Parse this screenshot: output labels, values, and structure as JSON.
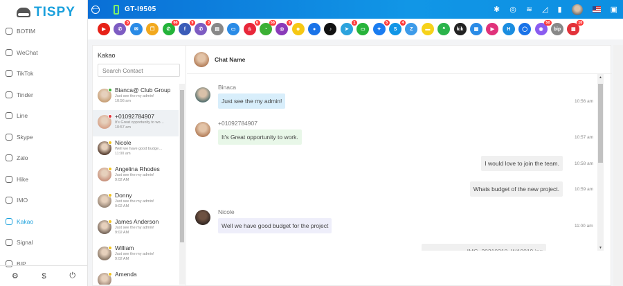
{
  "brand": {
    "name": "TISPY"
  },
  "sidebar": {
    "items": [
      {
        "label": "BOTIM",
        "icon": "botim-icon"
      },
      {
        "label": "WeChat",
        "icon": "wechat-icon"
      },
      {
        "label": "TikTok",
        "icon": "tiktok-icon"
      },
      {
        "label": "Tinder",
        "icon": "tinder-icon"
      },
      {
        "label": "Line",
        "icon": "line-icon"
      },
      {
        "label": "Skype",
        "icon": "skype-icon"
      },
      {
        "label": "Zalo",
        "icon": "zalo-icon"
      },
      {
        "label": "Hike",
        "icon": "hike-icon"
      },
      {
        "label": "IMO",
        "icon": "imo-icon"
      },
      {
        "label": "Kakao",
        "icon": "kakao-icon",
        "active": true
      },
      {
        "label": "Signal",
        "icon": "signal-icon"
      },
      {
        "label": "BIP",
        "icon": "bip-icon"
      }
    ],
    "footer": {
      "settings": "⚙",
      "pricing": "$",
      "logout": "⏻"
    }
  },
  "header": {
    "device": "GT-I9505",
    "back_glyph": "⟵",
    "icons": {
      "bluetooth": "✱",
      "location": "◎",
      "wifi": "≋",
      "signal": "◿",
      "battery": "▮",
      "gift": "▣"
    }
  },
  "apps": [
    {
      "name": "youtube",
      "color": "#e62117",
      "glyph": "▶",
      "badge": ""
    },
    {
      "name": "viber",
      "color": "#7d5cc2",
      "glyph": "✆",
      "badge": "5"
    },
    {
      "name": "email",
      "color": "#2a8be6",
      "glyph": "✉",
      "badge": ""
    },
    {
      "name": "files",
      "color": "#f2a81d",
      "glyph": "❐",
      "badge": ""
    },
    {
      "name": "whatsapp",
      "color": "#23b33a",
      "glyph": "✆",
      "badge": "66"
    },
    {
      "name": "facebook",
      "color": "#3b5cb8",
      "glyph": "f",
      "badge": "9"
    },
    {
      "name": "messenger-viber",
      "color": "#7d5cc2",
      "glyph": "✆",
      "badge": "3"
    },
    {
      "name": "clipboard",
      "color": "#888888",
      "glyph": "▤",
      "badge": ""
    },
    {
      "name": "screen",
      "color": "#2a8be6",
      "glyph": "▭",
      "badge": ""
    },
    {
      "name": "tinder",
      "color": "#e8273a",
      "glyph": "♨",
      "badge": "6"
    },
    {
      "name": "wechat",
      "color": "#3cb034",
      "glyph": "◔",
      "badge": "56"
    },
    {
      "name": "instagram",
      "color": "#8a3ab9",
      "glyph": "◎",
      "badge": "9"
    },
    {
      "name": "snapchat",
      "color": "#f6c813",
      "glyph": "☻",
      "badge": ""
    },
    {
      "name": "duo",
      "color": "#1a73e8",
      "glyph": "●",
      "badge": ""
    },
    {
      "name": "tiktok",
      "color": "#111111",
      "glyph": "♪",
      "badge": ""
    },
    {
      "name": "telegram",
      "color": "#2ca3dd",
      "glyph": "➤",
      "badge": "1"
    },
    {
      "name": "line",
      "color": "#27b33a",
      "glyph": "▭",
      "badge": ""
    },
    {
      "name": "messenger",
      "color": "#1a7cf0",
      "glyph": "✦",
      "badge": "5"
    },
    {
      "name": "skype",
      "color": "#1196e6",
      "glyph": "S",
      "badge": "4"
    },
    {
      "name": "zalo",
      "color": "#3d9be9",
      "glyph": "Z",
      "badge": ""
    },
    {
      "name": "kakao",
      "color": "#f6d21a",
      "glyph": "▬",
      "badge": ""
    },
    {
      "name": "hangouts",
      "color": "#2bb34b",
      "glyph": "❝",
      "badge": ""
    },
    {
      "name": "kik",
      "color": "#222222",
      "glyph": "kik",
      "badge": ""
    },
    {
      "name": "imo",
      "color": "#2a8be6",
      "glyph": "▦",
      "badge": ""
    },
    {
      "name": "video",
      "color": "#e0327a",
      "glyph": "▶",
      "badge": ""
    },
    {
      "name": "hike",
      "color": "#1a8de0",
      "glyph": "H",
      "badge": ""
    },
    {
      "name": "signal",
      "color": "#1a73e8",
      "glyph": "◯",
      "badge": ""
    },
    {
      "name": "chat-bubble",
      "color": "#8a5cf0",
      "glyph": "◉",
      "badge": "50"
    },
    {
      "name": "bip",
      "color": "#888888",
      "glyph": "bip",
      "badge": ""
    },
    {
      "name": "calendar",
      "color": "#e2323a",
      "glyph": "▦",
      "badge": "10"
    }
  ],
  "contacts": {
    "title": "Kakao",
    "search_placeholder": "Search Contact",
    "list": [
      {
        "name": "Bianca@ Club Group",
        "message": "Just see the my admin!",
        "time": "10:56 am",
        "status": "#3cb034",
        "avatar": "#c9a27a"
      },
      {
        "name": "+01092784907",
        "message": "It's Great opportunity to wo…",
        "time": "10:57 am",
        "status": "#e2323a",
        "avatar": "#d7a58c",
        "selected": true
      },
      {
        "name": "Nicole",
        "message": "Well we have good budge…",
        "time": "11:00 am",
        "status": "#f2c21d",
        "avatar": "#5b4335"
      },
      {
        "name": "Angelina Rhodes",
        "message": "Just see the my admin!",
        "time": "9:02 AM",
        "status": "#f2c21d",
        "avatar": "#c99580"
      },
      {
        "name": "Donny",
        "message": "Just see the my admin!",
        "time": "9:02 AM",
        "status": "#f2c21d",
        "avatar": "#9c8a7a"
      },
      {
        "name": "James Anderson",
        "message": "Just see the my admin!",
        "time": "9:02 AM",
        "status": "#f2c21d",
        "avatar": "#7a6a5e"
      },
      {
        "name": "William",
        "message": "Just see the my admin!",
        "time": "9:02 AM",
        "status": "#f2c21d",
        "avatar": "#8c7a6a"
      },
      {
        "name": "Amenda",
        "message": "",
        "time": "",
        "status": "#f2c21d",
        "avatar": "#a08878"
      }
    ]
  },
  "chat": {
    "title": "Chat Name",
    "messages": [
      {
        "sender": "Binaca",
        "text": "Just see the my admin!",
        "time": "10:56 am",
        "side": "in"
      },
      {
        "sender": "+01092784907",
        "text": "It's Great opportunity to work.",
        "time": "10:57 am",
        "side": "in"
      },
      {
        "sender": "",
        "text": "I would love to join the team.",
        "time": "10:58 am",
        "side": "out"
      },
      {
        "sender": "",
        "text": "Whats budget of the new project.",
        "time": "10:59 am",
        "side": "out"
      },
      {
        "sender": "Nicole",
        "text": "Well we have good budget for the project",
        "time": "11:00 am",
        "side": "in"
      },
      {
        "sender": "",
        "text": "IMG_20210318_WA0019.jpg",
        "time": "",
        "side": "out"
      }
    ]
  },
  "scroll_glyphs": {
    "up": "▲",
    "down": "▼"
  }
}
